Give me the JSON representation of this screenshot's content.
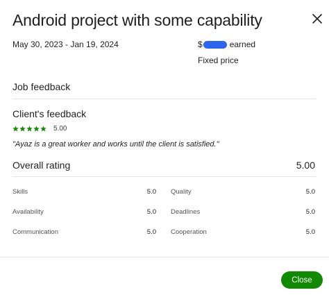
{
  "header": {
    "title": "Android project with some capability",
    "close_icon": "close-icon"
  },
  "summary": {
    "date_range": "May 30, 2023 - Jan 19, 2024",
    "earned_prefix": "$",
    "earned_suffix": "earned",
    "price_type": "Fixed price"
  },
  "job_feedback": {
    "heading": "Job feedback"
  },
  "client_feedback": {
    "heading": "Client's feedback",
    "stars": 5,
    "rating": "5.00",
    "comment": "\"Ayaz is a great worker and works until the client is satisfied.\""
  },
  "overall": {
    "label": "Overall rating",
    "value": "5.00"
  },
  "metrics": [
    {
      "label": "Skills",
      "value": "5.0"
    },
    {
      "label": "Quality",
      "value": "5.0"
    },
    {
      "label": "Availability",
      "value": "5.0"
    },
    {
      "label": "Deadlines",
      "value": "5.0"
    },
    {
      "label": "Communication",
      "value": "5.0"
    },
    {
      "label": "Cooperation",
      "value": "5.0"
    }
  ],
  "footer": {
    "close_label": "Close"
  },
  "colors": {
    "accent_green": "#108a00",
    "redaction_blue": "#2b66f2"
  }
}
